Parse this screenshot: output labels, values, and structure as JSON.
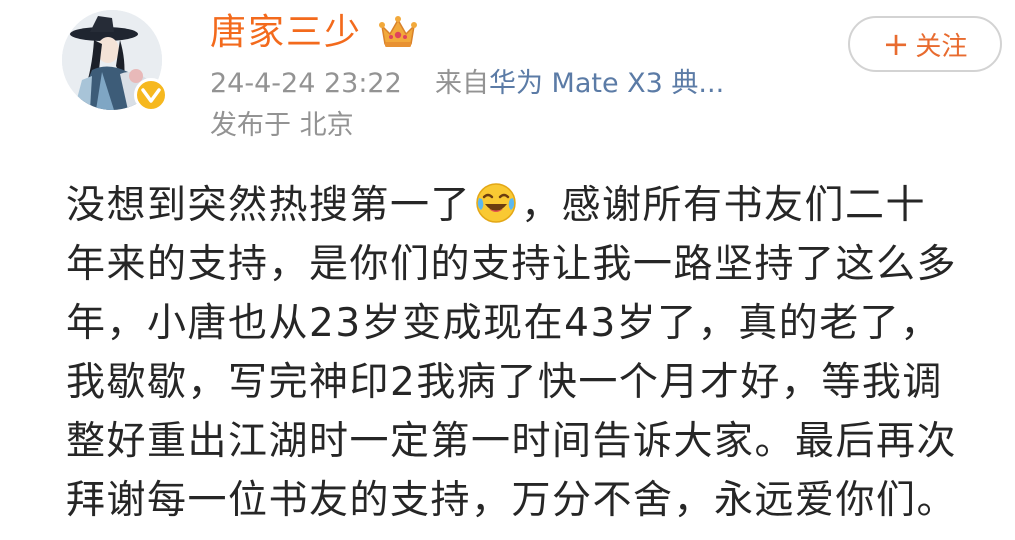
{
  "author": {
    "name": "唐家三少",
    "crown_icon": "crown-icon",
    "verified_icon": "verified-badge-icon"
  },
  "meta": {
    "timestamp": "24-4-24 23:22",
    "from_prefix": "来自",
    "device": "华为 Mate X3 典...",
    "location": "发布于 北京"
  },
  "follow": {
    "plus": "+",
    "label": "关注"
  },
  "post": {
    "line1_before": "没想到突然热搜第一了",
    "emoji": "laugh-cry-emoji",
    "line1_after": "，感谢所有书友们二十",
    "lines": [
      "年来的支持，是你们的支持让我一路坚持了这么多",
      "年，小唐也从23岁变成现在43岁了，真的老了，",
      "我歇歇，写完神印2我病了快一个月才好，等我调",
      "整好重出江湖时一定第一时间告诉大家。最后再次",
      "拜谢每一位书友的支持，万分不舍，永远爱你们。"
    ]
  },
  "colors": {
    "author_name": "#f36a1c",
    "meta_gray": "#939393",
    "source_link": "#5b7ba6",
    "follow_text": "#e86b2f",
    "body_text": "#262626",
    "badge": "#f6b81f"
  }
}
